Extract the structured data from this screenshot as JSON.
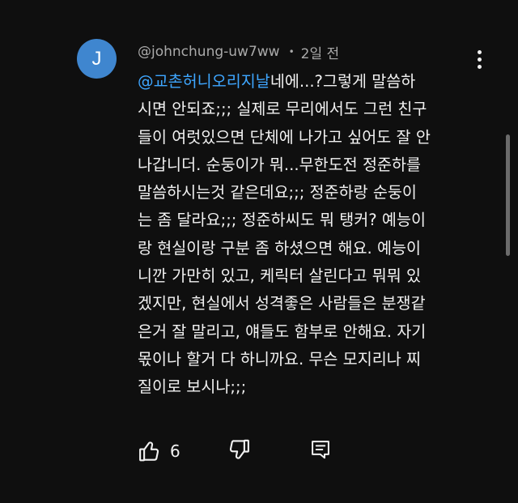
{
  "avatar": {
    "letter": "J",
    "color": "#3f86cf"
  },
  "comment": {
    "author": "@johnchung-uw7ww",
    "separator": "•",
    "time": "2일 전",
    "mention": "@교촌허니오리지날",
    "lines": [
      "네에...?그렇게 말씀하",
      "시면 안되죠;;; 실제로 무리에서도 그런 친구",
      "들이 여럿있으면 단체에 나가고 싶어도 잘 안",
      "나갑니더. 순둥이가 뭐...무한도전 정준하를",
      "말씀하시는것 같은데요;;; 정준하랑 순둥이",
      "는 좀 달라요;;; 정준하씨도 뭐 탱커? 예능이",
      "랑 현실이랑 구분 좀 하셨으면 해요. 예능이",
      "니깐 가만히 있고, 케릭터 살린다고 뭐뭐 있",
      "겠지만, 현실에서 성격좋은 사람들은 분쟁같",
      "은거 잘 말리고, 얘들도 함부로 안해요. 자기",
      "몫이나 할거 다 하니까요. 무슨 모지리나 찌",
      "질이로 보시나;;;"
    ],
    "like_count": "6"
  },
  "icons": {
    "like": "thumbs-up-icon",
    "dislike": "thumbs-down-icon",
    "reply": "comment-reply-icon",
    "more": "more-vertical-icon"
  },
  "colors": {
    "background": "#0f0f0f",
    "text": "#f1f1f1",
    "secondary_text": "#aaaaaa",
    "mention": "#3ea6ff"
  }
}
